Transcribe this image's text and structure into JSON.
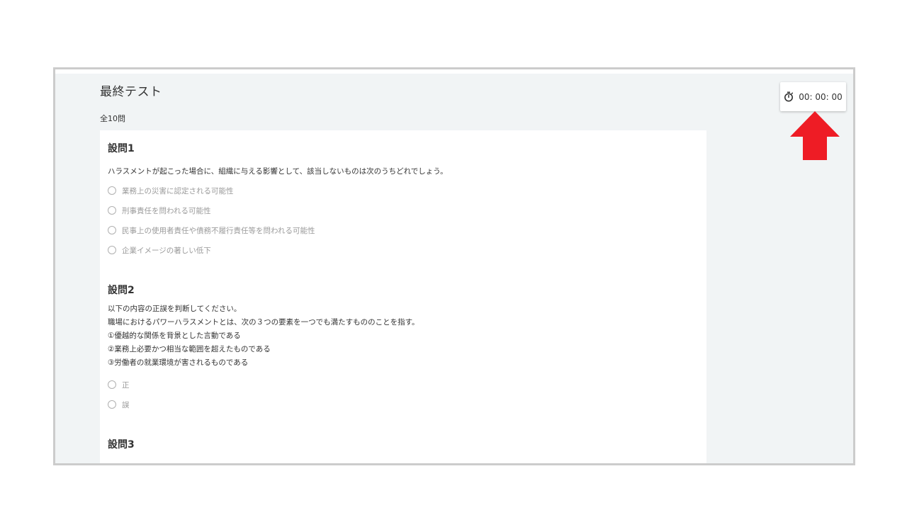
{
  "page": {
    "title": "最終テスト",
    "question_count": "全10問"
  },
  "timer": {
    "icon": "stopwatch-icon",
    "value": "00: 00: 00"
  },
  "annotation": {
    "icon": "red-arrow-up",
    "color": "#ee1c25"
  },
  "questions": [
    {
      "title": "設問1",
      "text": [
        "ハラスメントが起こった場合に、組織に与える影響として、該当しないものは次のうちどれでしょう。"
      ],
      "options": [
        "業務上の災害に認定される可能性",
        "刑事責任を問われる可能性",
        "民事上の使用者責任や債務不履行責任等を問われる可能性",
        "企業イメージの著しい低下"
      ]
    },
    {
      "title": "設問2",
      "text": [
        "以下の内容の正誤を判断してください。",
        "職場におけるパワーハラスメントとは、次の３つの要素を一つでも満たすもののことを指す。",
        "①優越的な関係を背景とした言動である",
        "②業務上必要かつ相当な範囲を超えたものである",
        "③労働者の就業環境が害されるものである"
      ],
      "options": [
        "正",
        "誤"
      ]
    },
    {
      "title": "設問3",
      "text": [],
      "options": []
    }
  ]
}
